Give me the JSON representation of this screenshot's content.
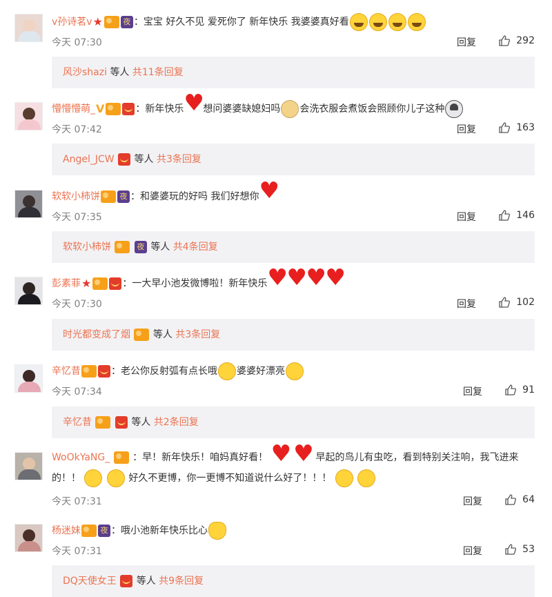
{
  "reply_label": "回复",
  "subreply_middle": "等人",
  "comments": [
    {
      "user": "v孙诗茗v",
      "text": "：宝宝 好久不见 爱死你了 新年快乐 我婆婆真好看",
      "time": "今天 07:30",
      "likes": "292",
      "sub_user": "风沙shazi",
      "sub_count": "共11条回复"
    },
    {
      "user": "懵懵懵萌_",
      "text_a": "：新年快乐",
      "text_b": "想问婆婆缺媳妇吗",
      "text_c": "会洗衣服会煮饭会照顾你儿子这种",
      "time": "今天 07:42",
      "likes": "163",
      "sub_user": "Angel_JCW",
      "sub_count": "共3条回复"
    },
    {
      "user": "软软小柿饼",
      "text": "：和婆婆玩的好吗 我们好想你",
      "time": "今天 07:35",
      "likes": "146",
      "sub_user": "软软小柿饼",
      "sub_count": "共4条回复"
    },
    {
      "user": "彭素菲",
      "text": "：一大早小池发微博啦！新年快乐",
      "time": "今天 07:30",
      "likes": "102",
      "sub_user": "时光都变成了烟",
      "sub_count": "共3条回复"
    },
    {
      "user": "辛忆昔",
      "text_a": "：老公你反射弧有点长哦",
      "text_b": "婆婆好漂亮",
      "time": "今天 07:34",
      "likes": "91",
      "sub_user": "辛忆昔",
      "sub_count": "共2条回复"
    },
    {
      "user": "WoOkYaNG_",
      "text_a": "：早！新年快乐！咱妈真好看！",
      "text_b": "早起的鸟儿有虫吃，看到特别关注响，我飞进来的！！",
      "text_c": "好久不更博，你一更博不知道说什么好了！！！",
      "time": "今天 07:31",
      "likes": "64"
    },
    {
      "user": "杨迷妹",
      "text": "：哦小池新年快乐比心",
      "time": "今天 07:31",
      "likes": "53",
      "sub_user": "DQ天使女王",
      "sub_count": "共9条回复"
    }
  ],
  "icons": {
    "avatar": "user-avatar",
    "thumb": "thumbs-up-icon",
    "vip": "vip-badge",
    "night": "night-badge",
    "redpacket": "red-packet-badge",
    "star": "star-badge",
    "verified": "verified-v-badge"
  },
  "colors": {
    "username": "#eb7350",
    "text": "#333333",
    "time": "#808080",
    "subbar": "#f2f2f5"
  }
}
